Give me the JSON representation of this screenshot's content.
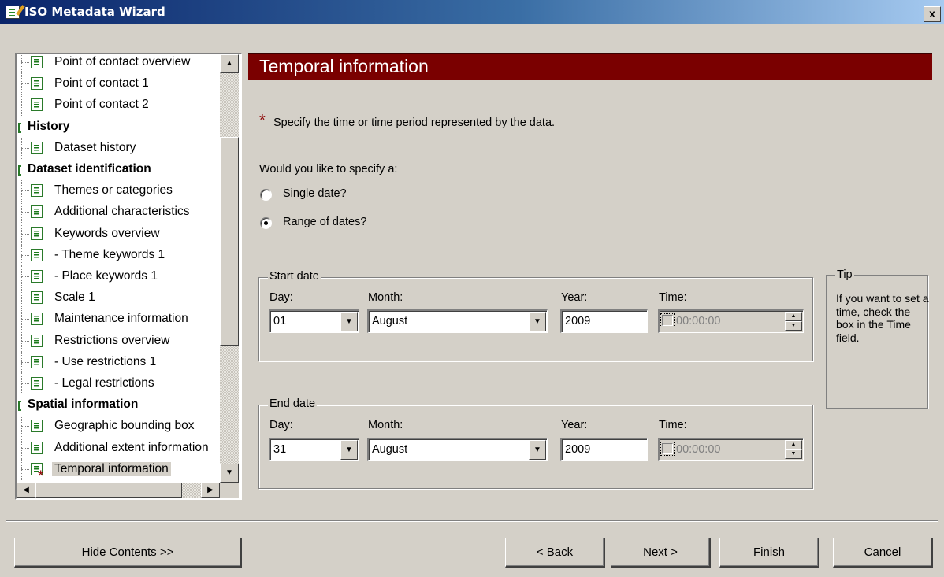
{
  "window": {
    "title": "ISO Metadata Wizard",
    "close_label": "x"
  },
  "tree": {
    "nodes": [
      {
        "label": "Point of contact overview",
        "kind": "page"
      },
      {
        "label": "Point of contact 1",
        "kind": "page"
      },
      {
        "label": "Point of contact 2",
        "kind": "page"
      },
      {
        "label": "History",
        "kind": "group"
      },
      {
        "label": "Dataset history",
        "kind": "page"
      },
      {
        "label": "Dataset identification",
        "kind": "group"
      },
      {
        "label": "Themes or categories",
        "kind": "page"
      },
      {
        "label": "Additional characteristics",
        "kind": "page"
      },
      {
        "label": "Keywords overview",
        "kind": "page"
      },
      {
        "label": "- Theme keywords 1",
        "kind": "page"
      },
      {
        "label": "- Place keywords 1",
        "kind": "page"
      },
      {
        "label": "Scale 1",
        "kind": "page"
      },
      {
        "label": "Maintenance information",
        "kind": "page"
      },
      {
        "label": "Restrictions overview",
        "kind": "page"
      },
      {
        "label": "- Use restrictions 1",
        "kind": "page"
      },
      {
        "label": "- Legal restrictions",
        "kind": "page"
      },
      {
        "label": "Spatial information",
        "kind": "group"
      },
      {
        "label": "Geographic bounding box",
        "kind": "page"
      },
      {
        "label": "Additional extent information",
        "kind": "page"
      },
      {
        "label": "Temporal information",
        "kind": "page",
        "selected": true,
        "required": true
      }
    ]
  },
  "page": {
    "header": "Temporal information",
    "required_mark": "*",
    "instruction": "Specify the time or time period represented by the data.",
    "question": "Would you like to specify a:",
    "options": [
      {
        "label": "Single date?",
        "checked": false
      },
      {
        "label": "Range of dates?",
        "checked": true
      }
    ],
    "start_date": {
      "title": "Start date",
      "day_label": "Day:",
      "month_label": "Month:",
      "year_label": "Year:",
      "time_label": "Time:",
      "day": "01",
      "month": "August",
      "year": "2009",
      "time": "00:00:00",
      "time_enabled": false
    },
    "end_date": {
      "title": "End date",
      "day_label": "Day:",
      "month_label": "Month:",
      "year_label": "Year:",
      "time_label": "Time:",
      "day": "31",
      "month": "August",
      "year": "2009",
      "time": "00:00:00",
      "time_enabled": false
    },
    "tip": {
      "title": "Tip",
      "text": "If you want to set a time, check the box in the Time field."
    }
  },
  "buttons": {
    "hide_contents": "Hide Contents >>",
    "back": "< Back",
    "next": "Next >",
    "finish": "Finish",
    "cancel": "Cancel"
  },
  "colors": {
    "header_bg": "#7a0000",
    "required": "#8b0000",
    "title_gradient_start": "#0a246a",
    "title_gradient_end": "#a6caf0"
  }
}
